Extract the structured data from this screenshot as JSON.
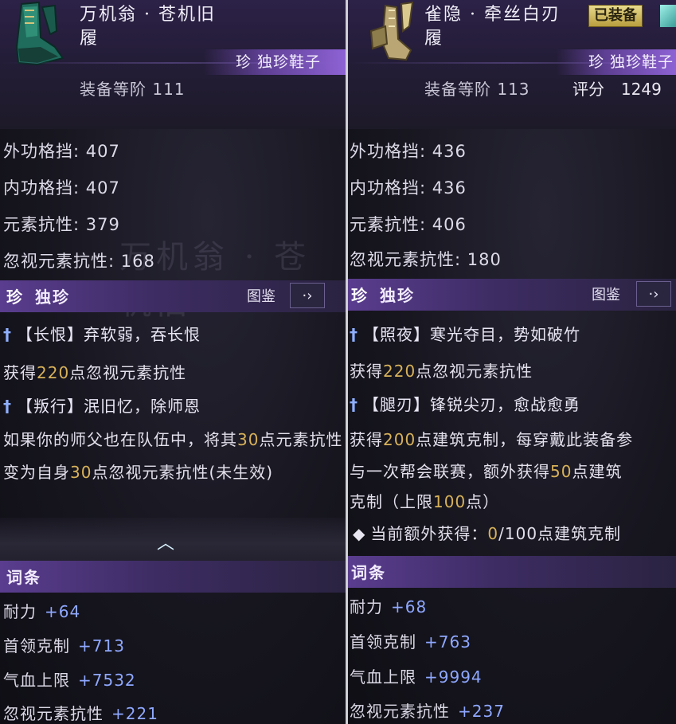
{
  "left": {
    "item_name_line1": "万机翁 · 苍机旧",
    "item_name_line2": "履",
    "rarity_tag": "珍 独珍鞋子",
    "gear_level": "装备等阶 111",
    "stats": [
      "外功格挡: 407",
      "内功格挡: 407",
      "元素抗性: 379",
      "忽视元素抗性: 168"
    ],
    "section_title_gem": "珍",
    "section_title": "独珍",
    "codex_label": "图鉴",
    "codex_icon": "arrow-right-icon",
    "effect1_name": "【长恨】弃软弱，吞长恨",
    "effect1_prefix": "获得",
    "effect1_value": "220",
    "effect1_suffix": "点忽视元素抗性",
    "effect2_name": "【叛行】泯旧忆，除师恩",
    "effect2_p1": "如果你的师父也在队伍中，将其",
    "effect2_v1": "30",
    "effect2_p2": "点元素抗性变为自身",
    "effect2_v2": "30",
    "effect2_p3": "点忽视元素抗性(未生效)",
    "attributes_title": "词条",
    "attributes": [
      {
        "label": "耐力",
        "value": "+64"
      },
      {
        "label": "首领克制",
        "value": "+713"
      },
      {
        "label": "气血上限",
        "value": "+7532"
      },
      {
        "label": "忽视元素抗性",
        "value": "+221"
      }
    ]
  },
  "right": {
    "item_name_line1": "雀隐 · 牵丝白刃",
    "item_name_line2": "履",
    "equipped_badge": "已装备",
    "rarity_tag": "珍 独珍鞋子",
    "gear_level": "装备等阶 113",
    "score_label": "评分",
    "score_value": "1249",
    "stats": [
      "外功格挡: 436",
      "内功格挡: 436",
      "元素抗性: 406",
      "忽视元素抗性: 180"
    ],
    "section_title_gem": "珍",
    "section_title": "独珍",
    "codex_label": "图鉴",
    "codex_icon": "arrow-right-icon",
    "effect1_name": "【照夜】寒光夺目，势如破竹",
    "effect1_prefix": "获得",
    "effect1_value": "220",
    "effect1_suffix": "点忽视元素抗性",
    "effect2_name": "【腿刃】锋锐尖刃，愈战愈勇",
    "effect2_l1_p1": "获得",
    "effect2_l1_v1": "200",
    "effect2_l1_p2": "点建筑克制，每穿戴此装备参",
    "effect2_l2_p1": "与一次帮会联赛，额外获得",
    "effect2_l2_v1": "50",
    "effect2_l2_p2": "点建筑",
    "effect2_l3_p1": "克制（上限",
    "effect2_l3_v1": "100",
    "effect2_l3_p2": "点）",
    "extra_prefix": "当前额外获得：",
    "extra_value": "0",
    "extra_suffix": "/100点建筑克制",
    "attributes_title": "词条",
    "attributes": [
      {
        "label": "耐力",
        "value": "+68"
      },
      {
        "label": "首领克制",
        "value": "+763"
      },
      {
        "label": "气血上限",
        "value": "+9994"
      },
      {
        "label": "忽视元素抗性",
        "value": "+237"
      }
    ]
  }
}
